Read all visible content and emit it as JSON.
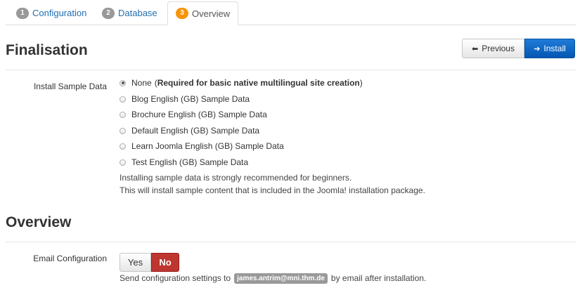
{
  "tabs": [
    {
      "num": "1",
      "label": "Configuration"
    },
    {
      "num": "2",
      "label": "Database"
    },
    {
      "num": "3",
      "label": "Overview"
    }
  ],
  "finalisation": {
    "title": "Finalisation",
    "prev_label": "Previous",
    "install_label": "Install"
  },
  "sample_data": {
    "label": "Install Sample Data",
    "options": [
      {
        "label": "None",
        "note": "Required for basic native multilingual site creation",
        "checked": true
      },
      {
        "label": "Blog English (GB) Sample Data",
        "checked": false
      },
      {
        "label": "Brochure English (GB) Sample Data",
        "checked": false
      },
      {
        "label": "Default English (GB) Sample Data",
        "checked": false
      },
      {
        "label": "Learn Joomla English (GB) Sample Data",
        "checked": false
      },
      {
        "label": "Test English (GB) Sample Data",
        "checked": false
      }
    ],
    "help_line1": "Installing sample data is strongly recommended for beginners.",
    "help_line2": "This will install sample content that is included in the Joomla! installation package."
  },
  "overview": {
    "title": "Overview",
    "email_label": "Email Configuration",
    "yes_label": "Yes",
    "no_label": "No",
    "selected": "No",
    "send_prefix": "Send configuration settings to",
    "email": "james.antrim@mni.thm.de",
    "send_suffix": "by email after installation."
  },
  "colors": {
    "accent_blue": "#0456b3",
    "active_tab_badge": "#f89406",
    "no_button_red": "#bd362f"
  }
}
